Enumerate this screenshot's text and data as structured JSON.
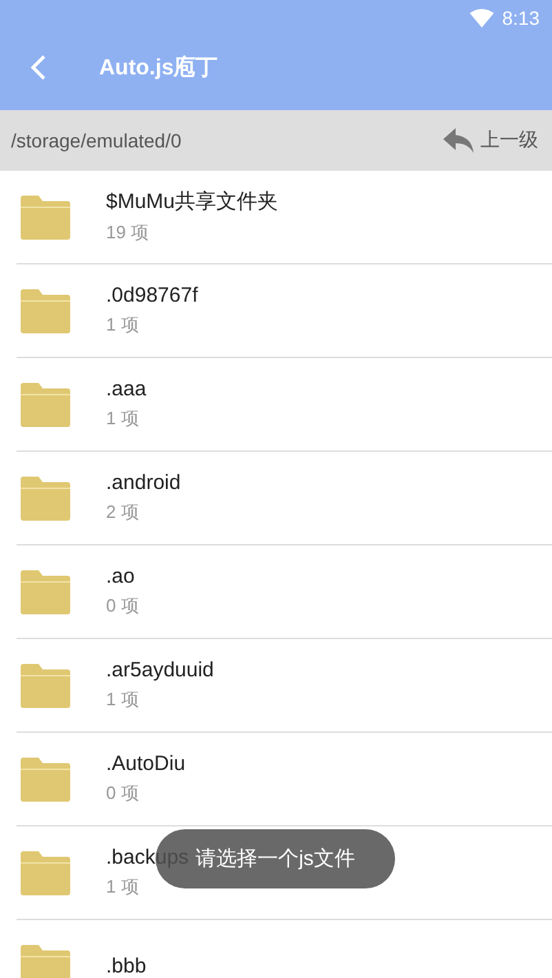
{
  "status_bar": {
    "time": "8:13"
  },
  "app_bar": {
    "title": "Auto.js庖丁"
  },
  "path_bar": {
    "path": "/storage/emulated/0",
    "up_label": "上一级"
  },
  "folders": [
    {
      "name": "$MuMu共享文件夹",
      "count": "19 项"
    },
    {
      "name": ".0d98767f",
      "count": "1 项"
    },
    {
      "name": ".aaa",
      "count": "1 项"
    },
    {
      "name": ".android",
      "count": "2 项"
    },
    {
      "name": ".ao",
      "count": "0 项"
    },
    {
      "name": ".ar5ayduuid",
      "count": "1 项"
    },
    {
      "name": ".AutoDiu",
      "count": "0 项"
    },
    {
      "name": ".backups",
      "count": "1 项"
    },
    {
      "name": ".bbb"
    }
  ],
  "toast": {
    "message": "请选择一个js文件"
  }
}
